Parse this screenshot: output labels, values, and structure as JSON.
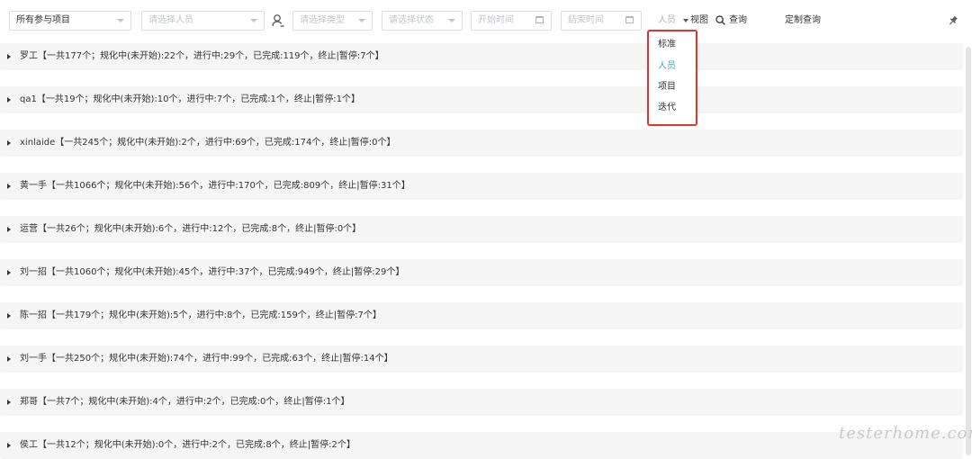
{
  "toolbar": {
    "project_filter": "所有参与项目",
    "person_placeholder": "请选择人员",
    "type_placeholder": "请选择类型",
    "status_placeholder": "请选择状态",
    "start_time_placeholder": "开始时间",
    "end_time_placeholder": "结束时间",
    "view_current": "人员",
    "view_label": "视图",
    "search_label": "查询",
    "custom_query_label": "定制查询"
  },
  "view_menu": {
    "items": [
      "标准",
      "人员",
      "项目",
      "迭代"
    ],
    "selected": "人员",
    "highlight_color": "#e5322d",
    "active_color": "#409eff"
  },
  "groups": [
    "罗工【一共177个；规化中(未开始):22个，进行中:29个，已完成:119个，终止|暂停:7个】",
    "qa1【一共19个；规化中(未开始):10个，进行中:7个，已完成:1个，终止|暂停:1个】",
    "xinlaide【一共245个；规化中(未开始):2个，进行中:69个，已完成:174个，终止|暂停:0个】",
    "黄一手【一共1066个；规化中(未开始):56个，进行中:170个，已完成:809个，终止|暂停:31个】",
    "运营【一共26个；规化中(未开始):6个，进行中:12个，已完成:8个，终止|暂停:0个】",
    "刘一招【一共1060个；规化中(未开始):45个，进行中:37个，已完成:949个，终止|暂停:29个】",
    "陈一招【一共179个；规化中(未开始):5个，进行中:8个，已完成:159个，终止|暂停:7个】",
    "刘一手【一共250个；规化中(未开始):74个，进行中:99个，已完成:63个，终止|暂停:14个】",
    "郑哥【一共7个；规化中(未开始):4个，进行中:2个，已完成:0个，终止|暂停:1个】",
    "侯工【一共12个；规化中(未开始):0个，进行中:2个，已完成:8个，终止|暂停:2个】"
  ],
  "watermark": "testerhome.com",
  "icons": {
    "user": "user-icon",
    "search": "search-icon",
    "pin": "pin-icon",
    "calendar": "calendar-icon",
    "expand": "caret-right-icon"
  }
}
